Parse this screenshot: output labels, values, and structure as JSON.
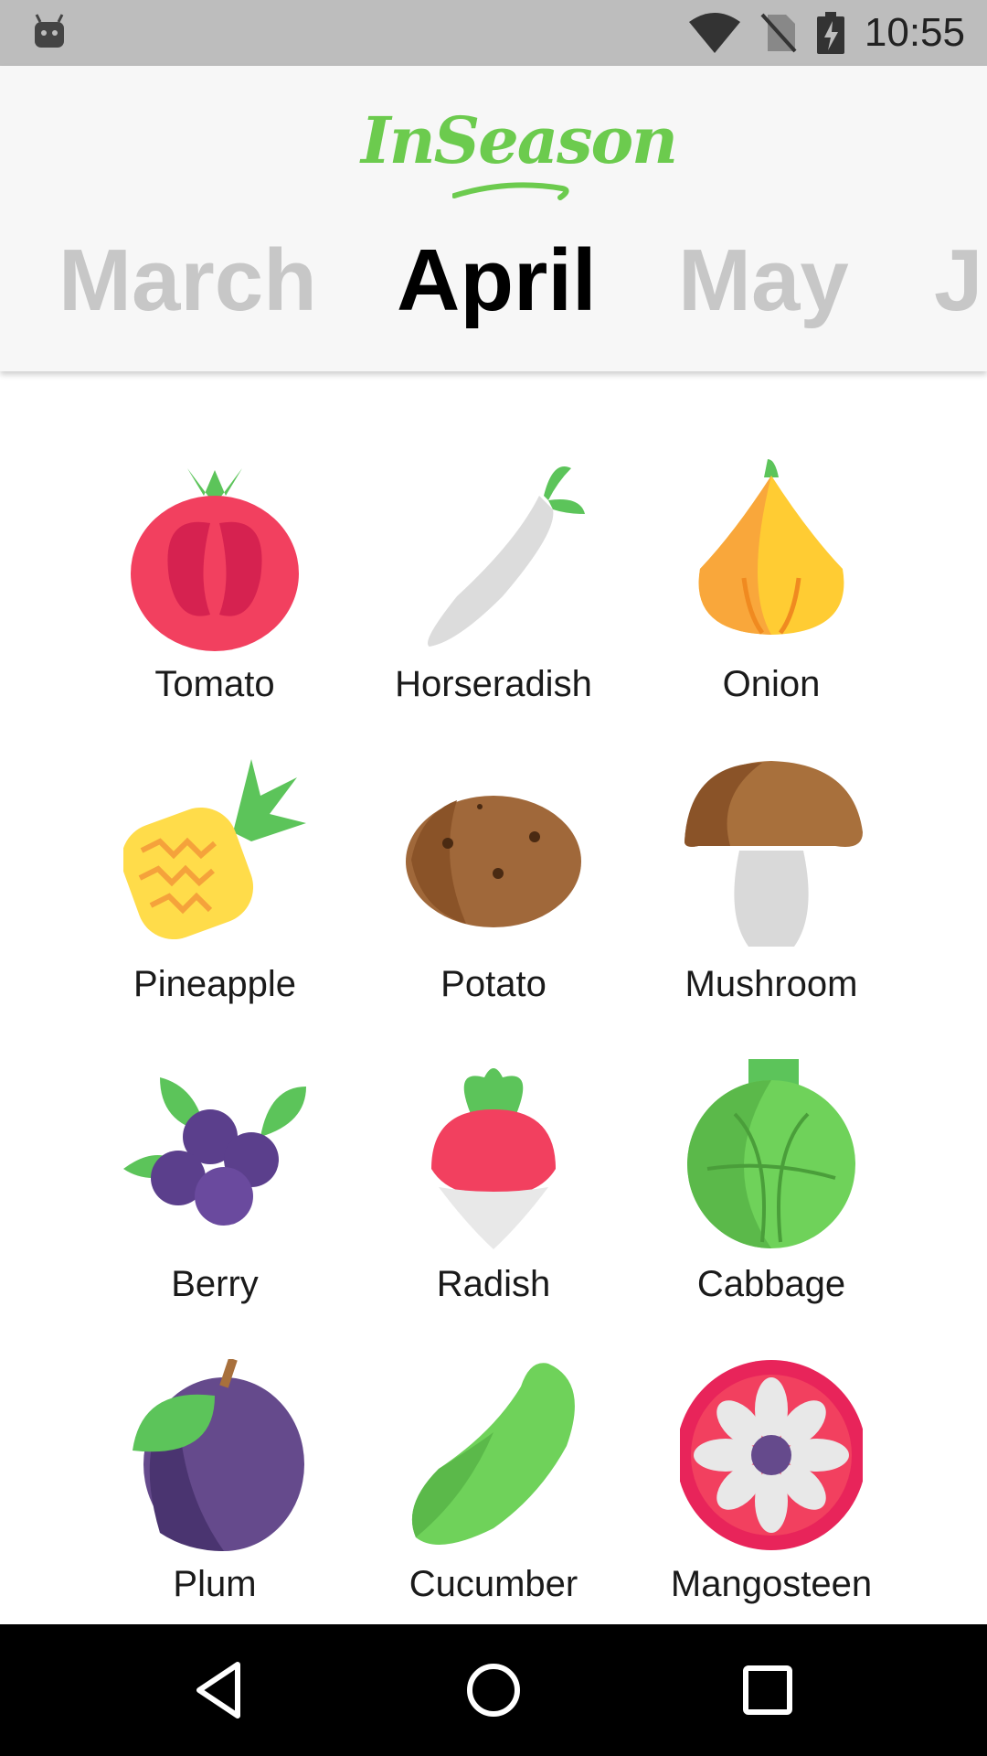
{
  "status_bar": {
    "time": "10:55",
    "icons": [
      "android-debug-icon",
      "wifi-icon",
      "no-sim-icon",
      "battery-charging-icon"
    ]
  },
  "app": {
    "title": "InSeason",
    "brand_color": "#6ccb4e"
  },
  "months": [
    {
      "label": "March",
      "active": false
    },
    {
      "label": "April",
      "active": true
    },
    {
      "label": "May",
      "active": false
    },
    {
      "label": "J",
      "active": false
    }
  ],
  "produce": [
    {
      "name": "Tomato",
      "icon": "tomato-icon"
    },
    {
      "name": "Horseradish",
      "icon": "horseradish-icon"
    },
    {
      "name": "Onion",
      "icon": "onion-icon"
    },
    {
      "name": "Pineapple",
      "icon": "pineapple-icon"
    },
    {
      "name": "Potato",
      "icon": "potato-icon"
    },
    {
      "name": "Mushroom",
      "icon": "mushroom-icon"
    },
    {
      "name": "Berry",
      "icon": "berry-icon"
    },
    {
      "name": "Radish",
      "icon": "radish-icon"
    },
    {
      "name": "Cabbage",
      "icon": "cabbage-icon"
    },
    {
      "name": "Plum",
      "icon": "plum-icon"
    },
    {
      "name": "Cucumber",
      "icon": "cucumber-icon"
    },
    {
      "name": "Mangosteen",
      "icon": "mangosteen-icon"
    }
  ],
  "nav_bar": {
    "buttons": [
      "back-icon",
      "home-icon",
      "recents-icon"
    ]
  }
}
